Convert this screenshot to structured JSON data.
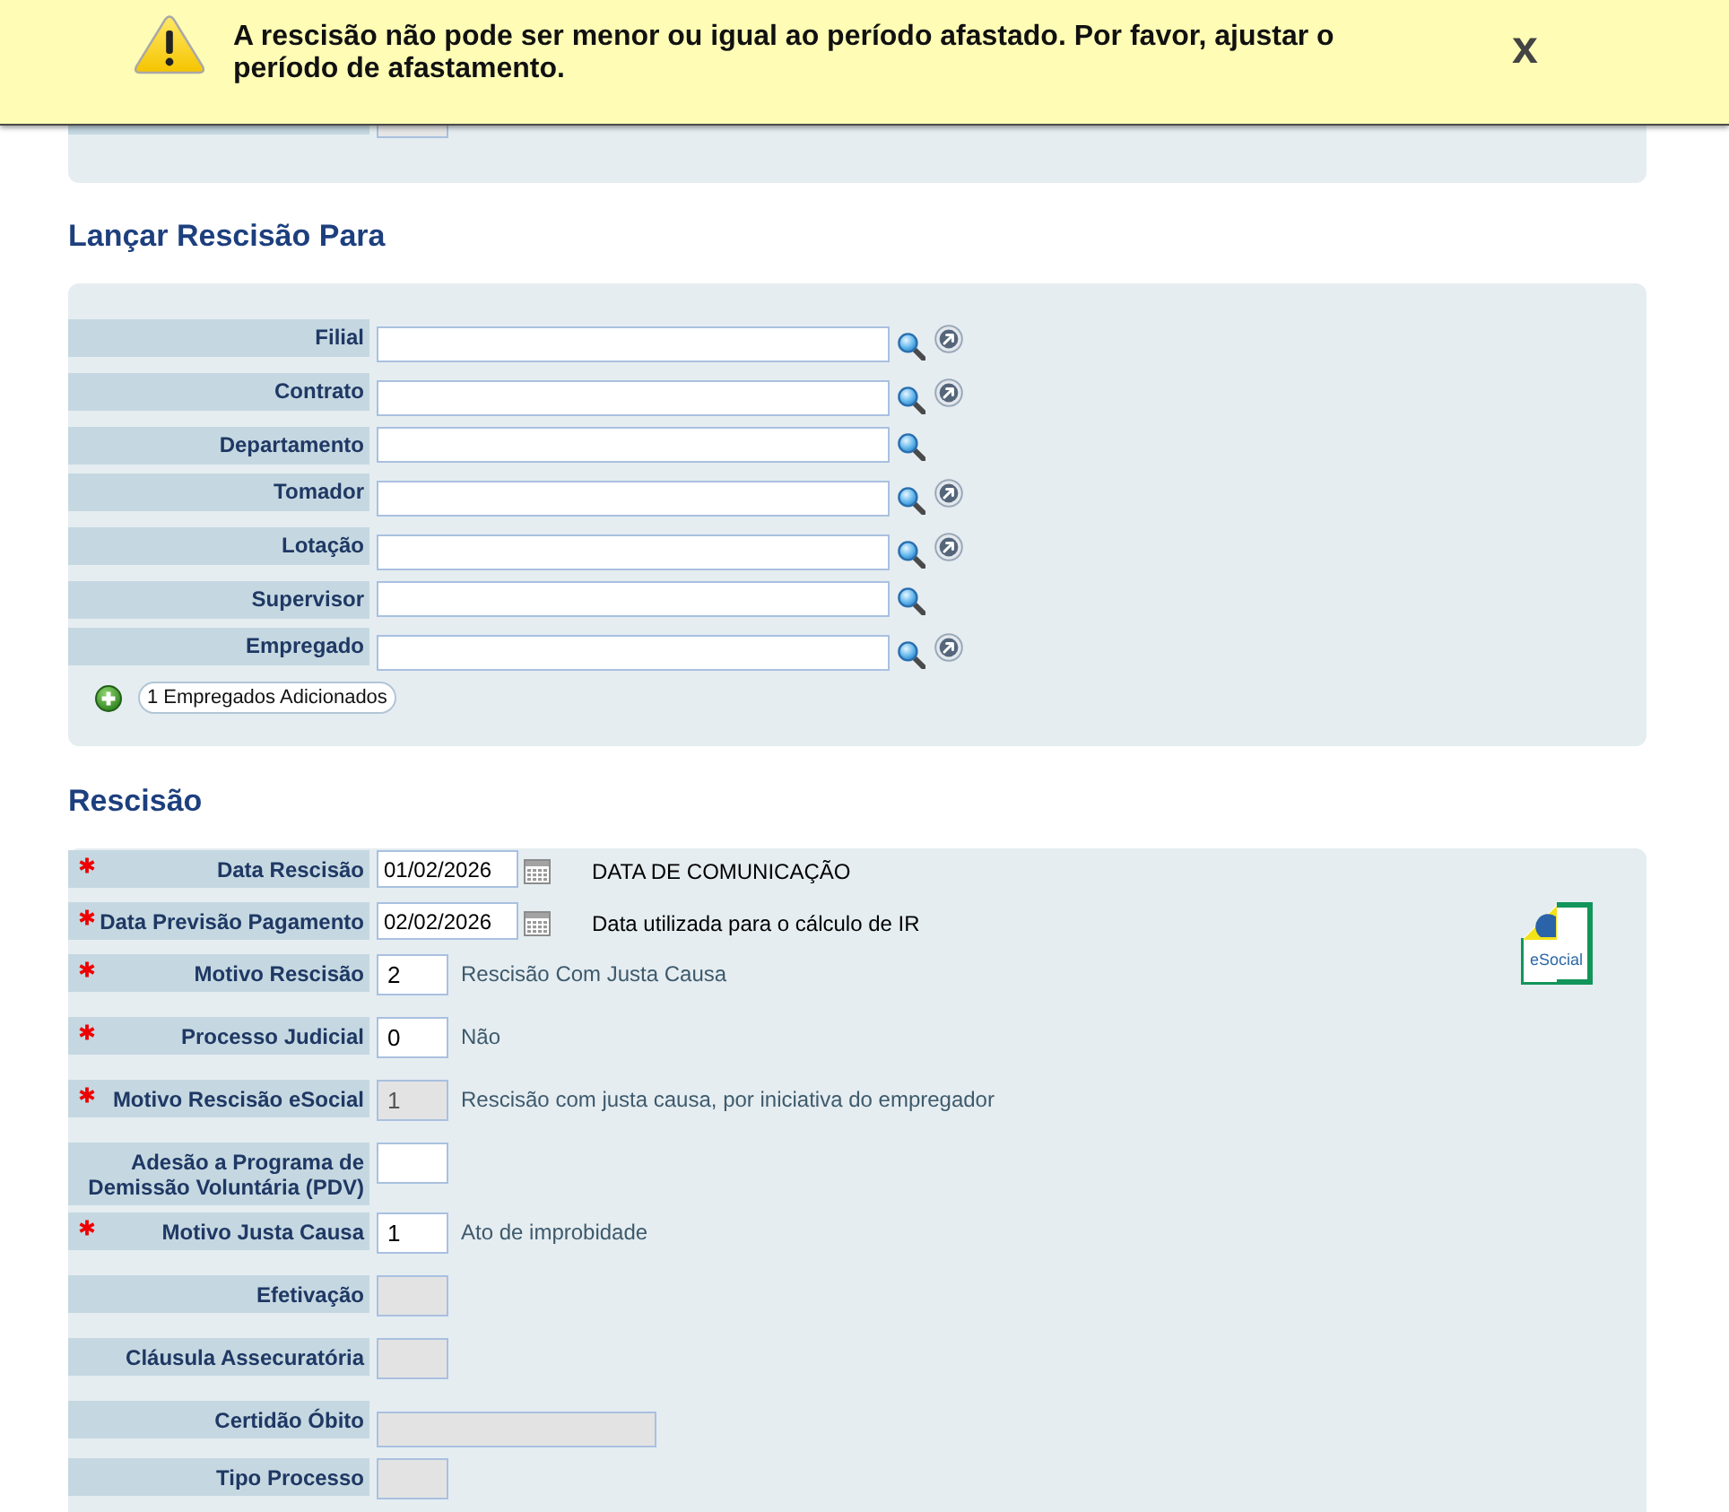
{
  "alert": {
    "message": "A rescisão não pode ser menor ou igual ao período afastado. Por favor, ajustar o período de afastamento.",
    "close_label": "x"
  },
  "sections": [
    {
      "title": "Lançar Rescisão Para",
      "fields": [
        {
          "label": "Filial",
          "kind": "lookup_open"
        },
        {
          "label": "Contrato",
          "kind": "lookup_open"
        },
        {
          "label": "Departamento",
          "kind": "lookup"
        },
        {
          "label": "Tomador",
          "kind": "lookup_open"
        },
        {
          "label": "Lotação",
          "kind": "lookup_open"
        },
        {
          "label": "Supervisor",
          "kind": "lookup"
        },
        {
          "label": "Empregado",
          "kind": "lookup_open"
        }
      ],
      "added_button": "1 Empregados Adicionados"
    },
    {
      "title": "Rescisão",
      "logo_text": "eSocial",
      "fields": [
        {
          "label": "Data Rescisão",
          "kind": "date",
          "required": true,
          "disabled": false,
          "value": "01/02/2026",
          "description": "DATA DE COMUNICAÇÃO"
        },
        {
          "label": "Data Previsão Pagamento",
          "kind": "date",
          "required": true,
          "disabled": false,
          "value": "02/02/2026",
          "description": "Data utilizada para o cálculo de IR"
        },
        {
          "label": "Motivo Rescisão",
          "kind": "code",
          "required": true,
          "disabled": false,
          "value": "2",
          "description": "Rescisão Com Justa Causa"
        },
        {
          "label": "Processo Judicial",
          "kind": "code",
          "required": true,
          "disabled": false,
          "value": "0",
          "description": "Não"
        },
        {
          "label": "Motivo Rescisão eSocial",
          "kind": "code",
          "required": true,
          "disabled": true,
          "value": "1",
          "description": "Rescisão com justa causa, por iniciativa do empregador"
        },
        {
          "label": "Adesão a Programa de Demissão Voluntária (PDV)",
          "kind": "code",
          "required": false,
          "disabled": false
        },
        {
          "label": "Motivo Justa Causa",
          "kind": "code",
          "required": true,
          "disabled": false,
          "value": "1",
          "description": "Ato de improbidade"
        },
        {
          "label": "Efetivação",
          "kind": "code",
          "required": false,
          "disabled": true
        },
        {
          "label": "Cláusula Assecuratória",
          "kind": "code",
          "required": false,
          "disabled": true
        },
        {
          "label": "Certidão Óbito",
          "kind": "wide",
          "required": false,
          "disabled": true
        },
        {
          "label": "Tipo Processo",
          "kind": "code",
          "required": false,
          "disabled": true
        }
      ]
    }
  ]
}
